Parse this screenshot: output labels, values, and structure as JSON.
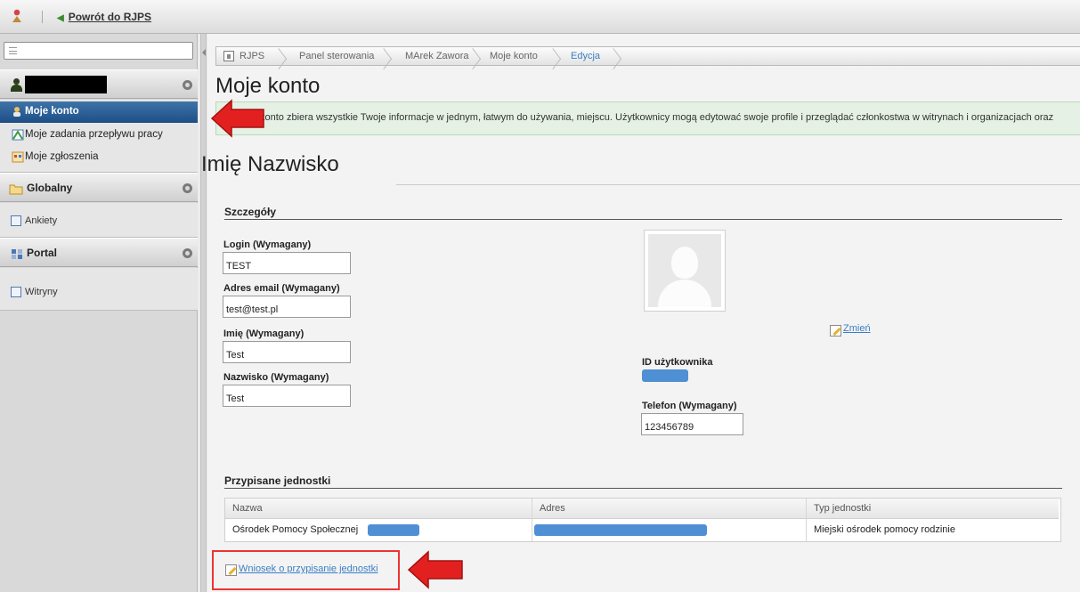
{
  "topbar": {
    "back_label": "Powrót do RJPS"
  },
  "sidebar": {
    "sections": [
      {
        "label": "",
        "redacted": true,
        "items": [
          {
            "label": "Moje konto",
            "active": true
          },
          {
            "label": "Moje zadania przepływu pracy"
          },
          {
            "label": "Moje zgłoszenia"
          }
        ]
      },
      {
        "label": "Globalny",
        "items": [
          {
            "label": "Ankiety"
          }
        ]
      },
      {
        "label": "Portal",
        "items": [
          {
            "label": "Witryny"
          }
        ]
      }
    ]
  },
  "breadcrumbs": [
    "RJPS",
    "Panel sterowania",
    "MArek Zawora",
    "Moje konto",
    "Edycja"
  ],
  "page": {
    "title": "Moje konto",
    "info_text": "konto zbiera wszystkie Twoje informacje w jednym, łatwym do używania, miejscu. Użytkownicy mogą edytować swoje profile i przeglądać członkostwa w witrynach i organizacjach oraz"
  },
  "profile": {
    "name": "Imię Nazwisko",
    "details_title": "Szczegóły",
    "fields": {
      "login": {
        "label": "Login (Wymagany)",
        "value": "TEST"
      },
      "email": {
        "label": "Adres email (Wymagany)",
        "value": "test@test.pl"
      },
      "first_name": {
        "label": "Imię (Wymagany)",
        "value": "Test"
      },
      "last_name": {
        "label": "Nazwisko (Wymagany)",
        "value": "Test"
      },
      "user_id_label": "ID użytkownika",
      "phone": {
        "label": "Telefon (Wymagany)",
        "value": "123456789"
      }
    },
    "change_label": "Zmień"
  },
  "units": {
    "title": "Przypisane jednostki",
    "columns": [
      "Nazwa",
      "Adres",
      "Typ jednostki"
    ],
    "rows": [
      {
        "name": "Ośrodek Pomocy Społecznej",
        "address": "",
        "type": "Miejski ośrodek pomocy rodzinie"
      }
    ],
    "request_label": "Wniosek o przypisanie jednostki"
  },
  "colors": {
    "accent": "#3a7fc4",
    "active_nav": "#1d4f86",
    "info_bg": "#e4f1e4",
    "annotation": "#e32020"
  }
}
